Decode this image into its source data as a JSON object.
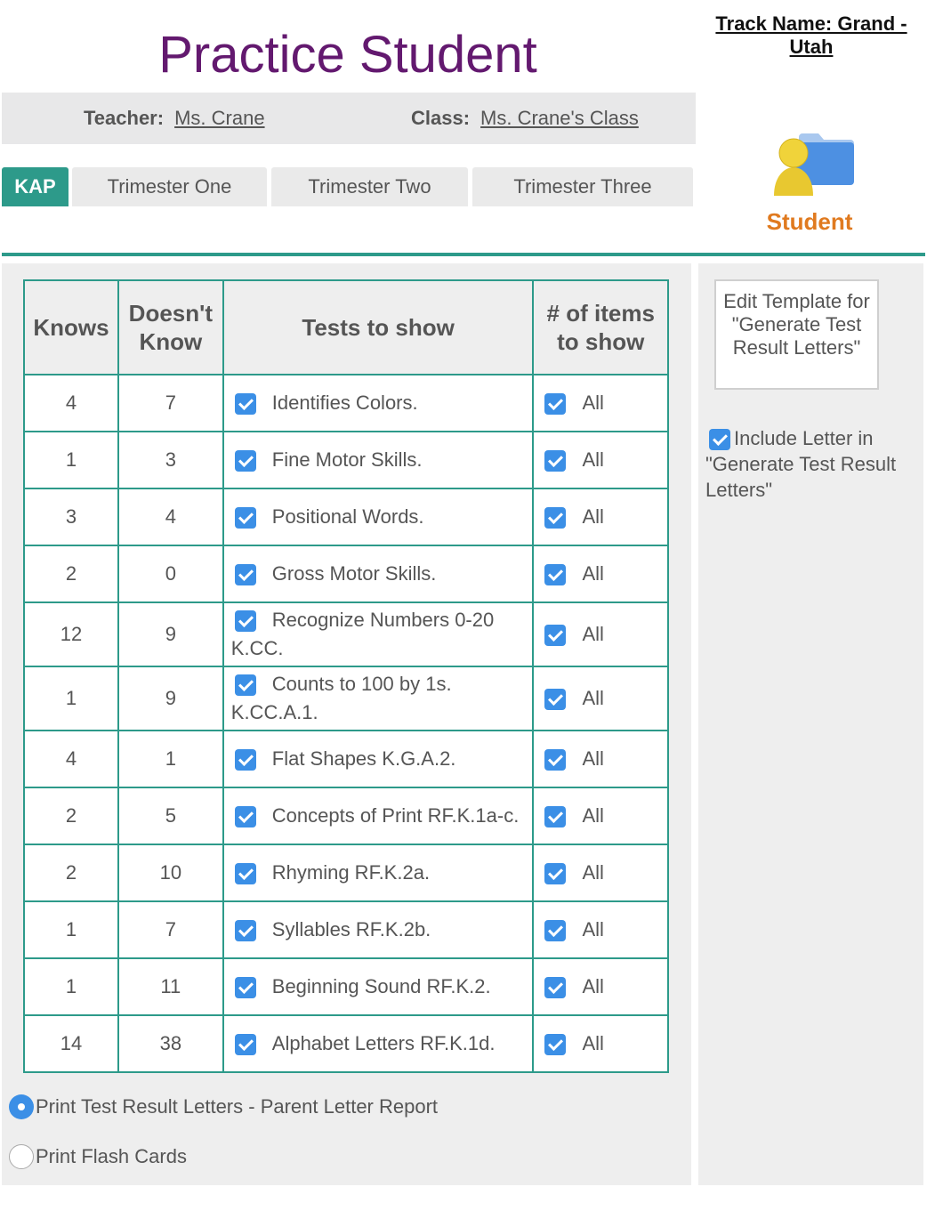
{
  "header": {
    "student_name": "Practice Student",
    "track_name": "Track Name: Grand - Utah",
    "teacher_label": "Teacher:",
    "teacher_name": "Ms. Crane",
    "class_label": "Class:",
    "class_name": "Ms. Crane's Class",
    "role_label": "Student",
    "role_icon": "student-folder-icon"
  },
  "tabs": [
    {
      "label": "KAP",
      "active": true
    },
    {
      "label": "Trimester One",
      "active": false
    },
    {
      "label": "Trimester Two",
      "active": false
    },
    {
      "label": "Trimester Three",
      "active": false
    }
  ],
  "table": {
    "headers": [
      "Knows",
      "Doesn't Know",
      "Tests to show",
      "# of items to show"
    ],
    "rows": [
      {
        "knows": "4",
        "doesnt_know": "7",
        "test": "Identifies Colors.",
        "test_checked": true,
        "items": "All",
        "items_checked": true
      },
      {
        "knows": "1",
        "doesnt_know": "3",
        "test": "Fine Motor Skills.",
        "test_checked": true,
        "items": "All",
        "items_checked": true
      },
      {
        "knows": "3",
        "doesnt_know": "4",
        "test": "Positional Words.",
        "test_checked": true,
        "items": "All",
        "items_checked": true
      },
      {
        "knows": "2",
        "doesnt_know": "0",
        "test": "Gross Motor Skills.",
        "test_checked": true,
        "items": "All",
        "items_checked": true
      },
      {
        "knows": "12",
        "doesnt_know": "9",
        "test": "Recognize Numbers 0-20 K.CC.",
        "test_checked": true,
        "items": "All",
        "items_checked": true
      },
      {
        "knows": "1",
        "doesnt_know": "9",
        "test": "Counts to 100 by 1s. K.CC.A.1.",
        "test_checked": true,
        "items": "All",
        "items_checked": true
      },
      {
        "knows": "4",
        "doesnt_know": "1",
        "test": "Flat Shapes K.G.A.2.",
        "test_checked": true,
        "items": "All",
        "items_checked": true
      },
      {
        "knows": "2",
        "doesnt_know": "5",
        "test": "Concepts of Print RF.K.1a-c.",
        "test_checked": true,
        "items": "All",
        "items_checked": true
      },
      {
        "knows": "2",
        "doesnt_know": "10",
        "test": "Rhyming RF.K.2a.",
        "test_checked": true,
        "items": "All",
        "items_checked": true
      },
      {
        "knows": "1",
        "doesnt_know": "7",
        "test": "Syllables RF.K.2b.",
        "test_checked": true,
        "items": "All",
        "items_checked": true
      },
      {
        "knows": "1",
        "doesnt_know": "11",
        "test": "Beginning Sound RF.K.2.",
        "test_checked": true,
        "items": "All",
        "items_checked": true
      },
      {
        "knows": "14",
        "doesnt_know": "38",
        "test": "Alphabet Letters RF.K.1d.",
        "test_checked": true,
        "items": "All",
        "items_checked": true
      }
    ]
  },
  "print_options": [
    {
      "label": "Print Test Result Letters - Parent Letter Report",
      "selected": true
    },
    {
      "label": "Print Flash Cards",
      "selected": false
    }
  ],
  "sidebar": {
    "edit_template_label": "Edit Template for \"Generate Test Result Letters\"",
    "include_letter_label": "Include Letter in \"Generate Test Result Letters\"",
    "include_letter_checked": true
  },
  "colors": {
    "title": "#63196f",
    "accent": "#2d9a8a",
    "student": "#e07a1f",
    "checkbox": "#3b8fe6"
  }
}
